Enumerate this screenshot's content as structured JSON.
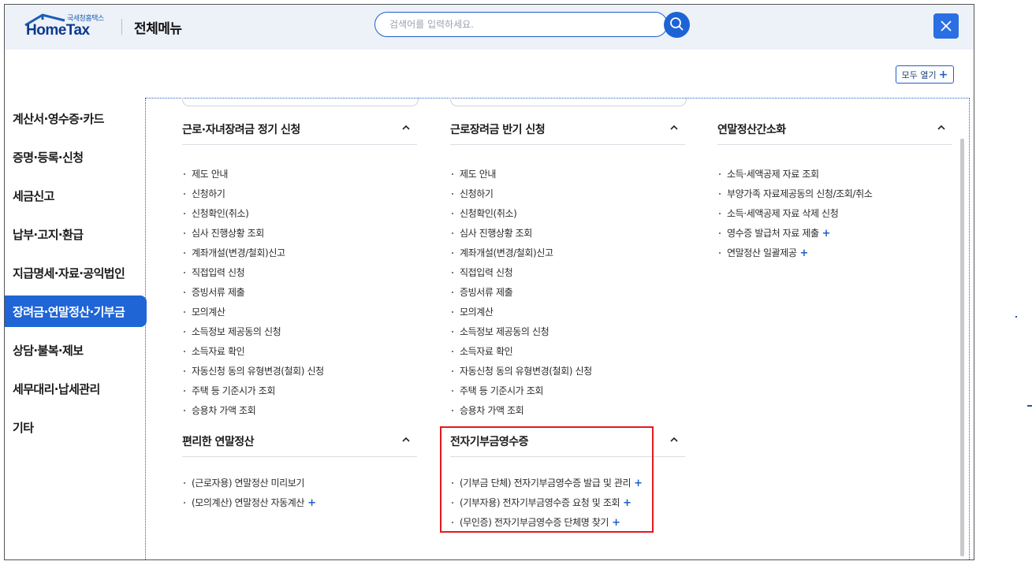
{
  "header": {
    "logo_kor": "국세청홈택스",
    "logo_eng": "HomeTax",
    "title": "전체메뉴",
    "search_placeholder": "검색어를 입력하세요.",
    "search_icon": "search-icon",
    "close_icon": "close-icon"
  },
  "toolbar": {
    "open_all_label": "모두 열기",
    "open_all_icon": "+"
  },
  "sidebar": {
    "items": [
      {
        "label": "계산서·영수증·카드"
      },
      {
        "label": "증명·등록·신청"
      },
      {
        "label": "세금신고"
      },
      {
        "label": "납부·고지·환급"
      },
      {
        "label": "지급명세·자료·공익법인"
      },
      {
        "label": "장려금·연말정산·기부금",
        "active": true
      },
      {
        "label": "상담·불복·제보"
      },
      {
        "label": "세무대리·납세관리"
      },
      {
        "label": "기타"
      }
    ]
  },
  "sections": {
    "s1": {
      "title": "근로·자녀장려금 정기 신청",
      "items": [
        "제도 안내",
        "신청하기",
        "신청확인(취소)",
        "심사 진행상황 조회",
        "계좌개설(변경/철회)신고",
        "직접입력 신청",
        "증빙서류 제출",
        "모의계산",
        "소득정보 제공동의 신청",
        "소득자료 확인",
        "자동신청 동의 유형변경(철회) 신청",
        "주택 등 기준시가 조회",
        "승용차 가액 조회"
      ]
    },
    "s2": {
      "title": "근로장려금 반기 신청",
      "items": [
        "제도 안내",
        "신청하기",
        "신청확인(취소)",
        "심사 진행상황 조회",
        "계좌개설(변경/철회)신고",
        "직접입력 신청",
        "증빙서류 제출",
        "모의계산",
        "소득정보 제공동의 신청",
        "소득자료 확인",
        "자동신청 동의 유형변경(철회) 신청",
        "주택 등 기준시가 조회",
        "승용차 가액 조회"
      ]
    },
    "s3": {
      "title": "연말정산간소화",
      "items": [
        "소득·세액공제 자료 조회",
        "부양가족 자료제공동의 신청/조회/취소",
        "소득·세액공제 자료 삭제 신청",
        "영수증 발급처 자료 제출",
        "연말정산 일괄제공"
      ]
    },
    "s4": {
      "title": "편리한 연말정산",
      "items": [
        "(근로자용) 연말정산 미리보기",
        "(모의계산) 연말정산 자동계산"
      ]
    },
    "s5": {
      "title": "전자기부금영수증",
      "items": [
        "(기부금 단체) 전자기부금영수증 발급 및 관리",
        "(기부자용) 전자기부금영수증 요청 및 조회",
        "(무인증) 전자기부금영수증 단체명 찾기"
      ]
    }
  },
  "colors": {
    "accent": "#1f65d6",
    "header_bg": "#edf1f8",
    "highlight": "#e21a1a"
  }
}
